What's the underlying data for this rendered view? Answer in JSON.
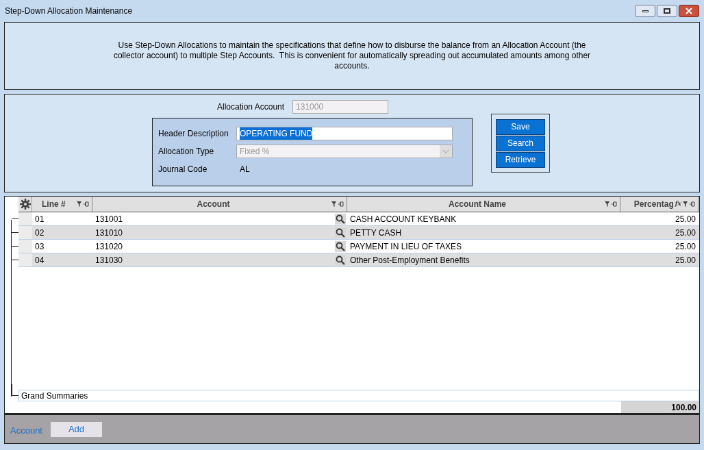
{
  "window": {
    "title": "Step-Down Allocation Maintenance"
  },
  "description": "Use Step-Down Allocations to maintain the specifications that define how to disburse the balance from an Allocation Account (the collector account) to multiple Step Accounts.  This is convenient for automatically spreading out accumulated amounts among other accounts.",
  "form": {
    "allocation_account": {
      "label": "Allocation Account",
      "value": "131000",
      "disabled": true
    },
    "header_description": {
      "label": "Header Description",
      "value": "OPERATING FUND"
    },
    "allocation_type": {
      "label": "Allocation Type",
      "value": "Fixed %",
      "disabled": true
    },
    "journal_code": {
      "label": "Journal Code",
      "value": "AL"
    }
  },
  "buttons": [
    "Save",
    "Search",
    "Retrieve"
  ],
  "table": {
    "columns": [
      "Line #",
      "Account",
      "Account Name",
      "Percentag"
    ],
    "formula_symbol": "fx",
    "rows": [
      {
        "line": "01",
        "account": "131001",
        "name": "CASH ACCOUNT KEYBANK",
        "percentage": "25.00"
      },
      {
        "line": "02",
        "account": "131010",
        "name": "PETTY CASH",
        "percentage": "25.00"
      },
      {
        "line": "03",
        "account": "131020",
        "name": "PAYMENT IN LIEU OF TAXES",
        "percentage": "25.00"
      },
      {
        "line": "04",
        "account": "131030",
        "name": "Other Post-Employment Benefits",
        "percentage": "25.00"
      }
    ],
    "summary_label": "Grand Summaries",
    "total": "100.00"
  },
  "footer": {
    "link": "Account",
    "button": "Add"
  }
}
